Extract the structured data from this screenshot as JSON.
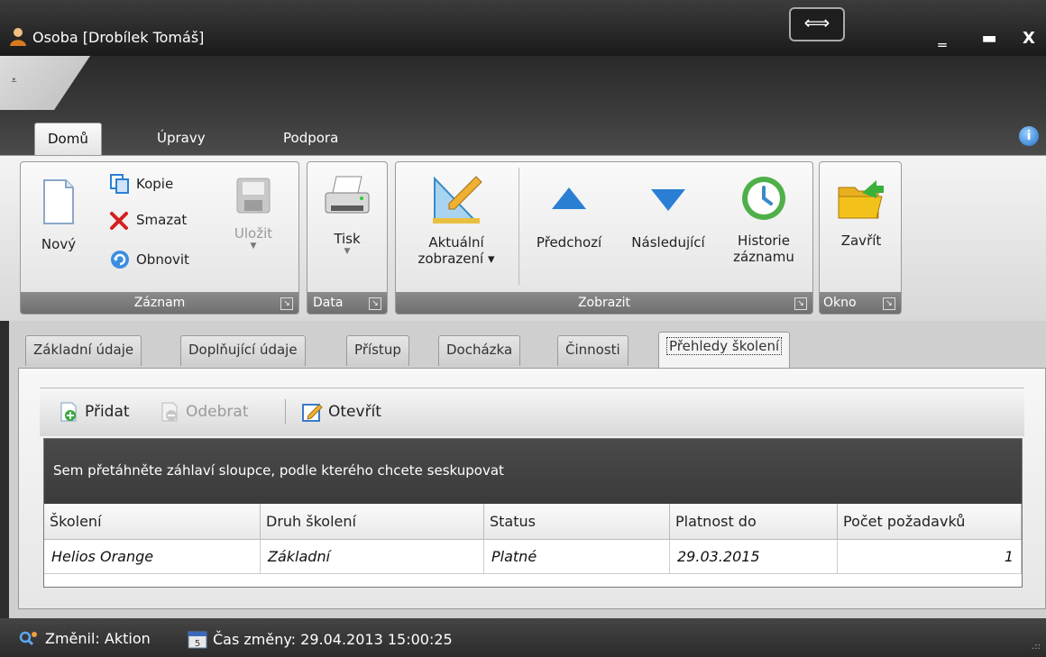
{
  "window": {
    "title": "Osoba [Drobílek Tomáš]",
    "resize_glyph": "⟺",
    "minimize": "‗",
    "maximize": "▬",
    "close": "X"
  },
  "qat": {
    "glyph": "⩡"
  },
  "ribbon_tabs": [
    "Domů",
    "Úpravy",
    "Podpora"
  ],
  "info_glyph": "i",
  "ribbon": {
    "zaznam": {
      "label": "Záznam",
      "novy": "Nový",
      "kopie": "Kopie",
      "smazat": "Smazat",
      "obnovit": "Obnovit",
      "ulozit": "Uložit"
    },
    "data": {
      "label": "Data",
      "tisk": "Tisk"
    },
    "zobrazit": {
      "label": "Zobrazit",
      "aktualni_1": "Aktuální",
      "aktualni_2": "zobrazení ▾",
      "predchozi": "Předchozí",
      "nasledujici": "Následující",
      "historie_1": "Historie",
      "historie_2": "záznamu"
    },
    "okno": {
      "label": "Okno",
      "zavrit": "Zavřít"
    },
    "launcher_glyph": "↘"
  },
  "doc_tabs": [
    "Základní údaje",
    "Doplňující údaje",
    "Přístup",
    "Docházka",
    "Činnosti",
    "Přehledy školení"
  ],
  "toolbar": {
    "pridat": "Přidat",
    "odebrat": "Odebrat",
    "otevrit": "Otevřít"
  },
  "grid": {
    "group_panel_text": "Sem přetáhněte záhlaví sloupce, podle kterého chcete seskupovat",
    "columns": [
      "Školení",
      "Druh školení",
      "Status",
      "Platnost do",
      "Počet požadavků"
    ],
    "rows": [
      [
        "Helios Orange",
        "Základní",
        "Platné",
        "29.03.2015",
        "1"
      ]
    ]
  },
  "status": {
    "changed_by": "Změnil: Aktion",
    "changed_at": "Čas změny: 29.04.2013 15:00:25",
    "grip": ".::"
  },
  "colors": {
    "accent_blue": "#2a7fd4",
    "delete_red": "#d42020",
    "folder_yellow": "#f2c21b"
  }
}
